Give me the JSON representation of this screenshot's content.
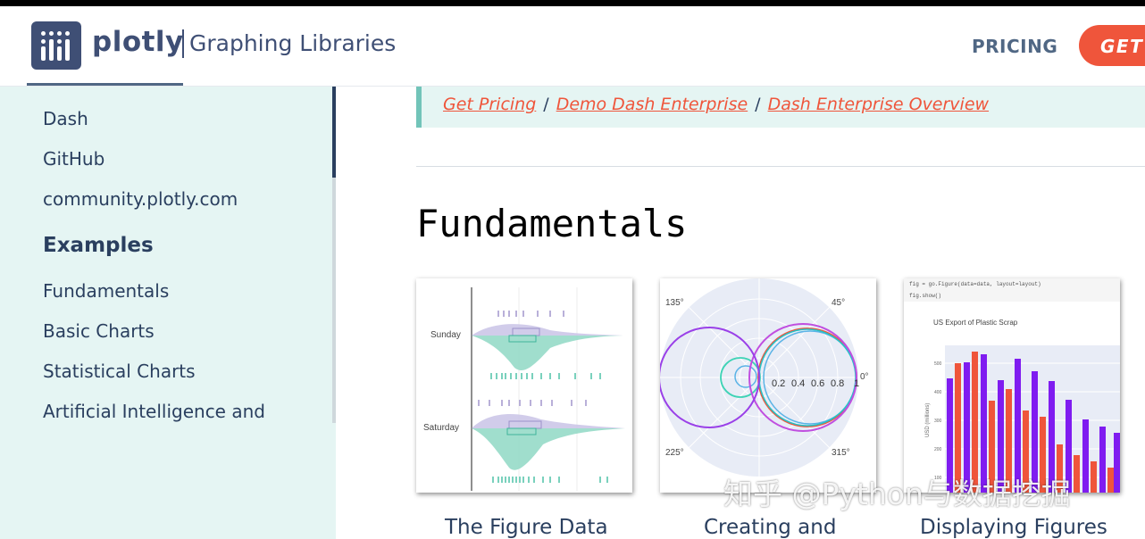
{
  "header": {
    "brand": "plotly",
    "subtitle": "Graphing Libraries",
    "nav_pricing": "PRICING",
    "nav_get": "GET"
  },
  "sidebar": {
    "links_top": [
      "Dash",
      "GitHub",
      "community.plotly.com"
    ],
    "heading": "Examples",
    "links": [
      "Fundamentals",
      "Basic Charts",
      "Statistical Charts",
      "Artificial Intelligence and"
    ]
  },
  "breadcrumb": {
    "items": [
      "Get Pricing",
      "Demo Dash Enterprise",
      "Dash Enterprise Overview"
    ],
    "separator": "/"
  },
  "main": {
    "section_title": "Fundamentals",
    "cards": [
      {
        "title": "The Figure Data",
        "thumb": {
          "labels": [
            "Sunday",
            "Saturday"
          ]
        }
      },
      {
        "title": "Creating and",
        "thumb": {
          "angles": [
            "135°",
            "45°",
            "0°",
            "225°",
            "315°"
          ],
          "radial_ticks": [
            "0.2",
            "0.4",
            "0.6",
            "0.8",
            "1"
          ]
        }
      },
      {
        "title": "Displaying Figures",
        "thumb": {
          "code": [
            "fig = go.Figure(data=data, layout=layout)",
            "fig.show()"
          ],
          "chart_title": "US Export of Plastic Scrap",
          "ylabel": "USD (millions)",
          "yticks": [
            "500",
            "400",
            "300",
            "200",
            "100"
          ]
        }
      }
    ]
  },
  "watermark": "知乎 @Python与数据挖掘",
  "colors": {
    "accent": "#ef553b",
    "brand": "#3f4f75",
    "sidebar_bg": "#e5f5f3",
    "crumb_border": "#72c4b9"
  }
}
